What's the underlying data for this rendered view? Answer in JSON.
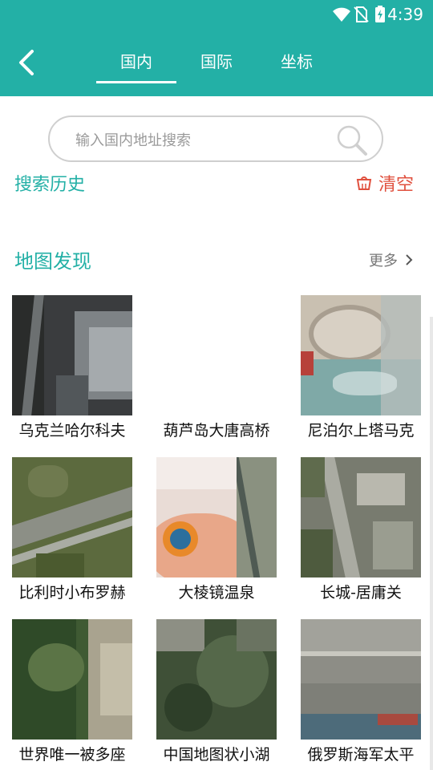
{
  "status_bar": {
    "time": "4:39"
  },
  "tabs": [
    {
      "label": "国内",
      "active": true
    },
    {
      "label": "国际",
      "active": false
    },
    {
      "label": "坐标",
      "active": false
    }
  ],
  "search": {
    "placeholder": "输入国内地址搜索"
  },
  "history": {
    "title": "搜索历史",
    "clear_label": "清空"
  },
  "discover": {
    "title": "地图发现",
    "more_label": "更多",
    "items": [
      {
        "label": "乌克兰哈尔科夫"
      },
      {
        "label": "葫芦岛大唐高桥"
      },
      {
        "label": "尼泊尔上塔马克"
      },
      {
        "label": "比利时小布罗赫"
      },
      {
        "label": "大棱镜温泉"
      },
      {
        "label": "长城-居庸关"
      },
      {
        "label": "世界唯一被多座"
      },
      {
        "label": "中国地图状小湖"
      },
      {
        "label": "俄罗斯海军太平"
      }
    ]
  },
  "colors": {
    "accent": "#23b0a6",
    "clear": "#e0503e"
  }
}
